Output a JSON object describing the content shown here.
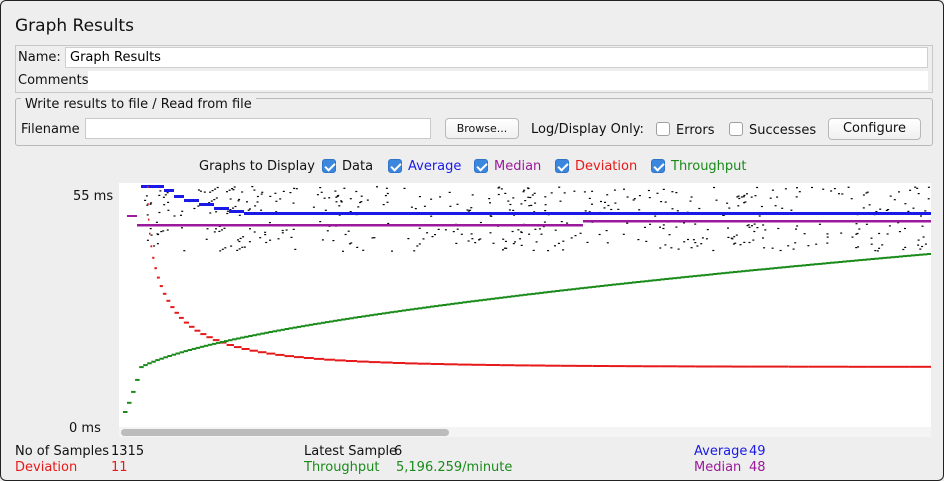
{
  "panel": {
    "title": "Graph Results"
  },
  "name_field": {
    "label": "Name:",
    "value": "Graph Results"
  },
  "comments_field": {
    "label": "Comments:",
    "value": ""
  },
  "file_group": {
    "title": "Write results to file / Read from file",
    "filename_label": "Filename",
    "filename_value": "",
    "browse_label": "Browse...",
    "log_display_label": "Log/Display Only:",
    "errors_label": "Errors",
    "errors_checked": false,
    "successes_label": "Successes",
    "successes_checked": false,
    "configure_label": "Configure"
  },
  "graphs_to_display": {
    "label": "Graphs to Display",
    "options": [
      {
        "label": "Data",
        "checked": true,
        "color": "#000000"
      },
      {
        "label": "Average",
        "checked": true,
        "color": "#1a1ae6"
      },
      {
        "label": "Median",
        "checked": true,
        "color": "#9b1a9b"
      },
      {
        "label": "Deviation",
        "checked": true,
        "color": "#e61a1a"
      },
      {
        "label": "Throughput",
        "checked": true,
        "color": "#1a8a1a"
      }
    ]
  },
  "axis": {
    "y_max_label": "55 ms",
    "y_min_label": "0 ms"
  },
  "stats": {
    "samples_label": "No of Samples",
    "samples_value": "1315",
    "deviation_label": "Deviation",
    "deviation_value": "11",
    "latest_label": "Latest Sample",
    "latest_value": "6",
    "throughput_label": "Throughput",
    "throughput_value": "5,196.259/minute",
    "average_label": "Average",
    "average_value": "49",
    "median_label": "Median",
    "median_value": "48"
  },
  "colors": {
    "data": "#000000",
    "average": "#1a1ae6",
    "median": "#9b1a9b",
    "deviation": "#e61a1a",
    "throughput": "#1a8a1a"
  }
}
